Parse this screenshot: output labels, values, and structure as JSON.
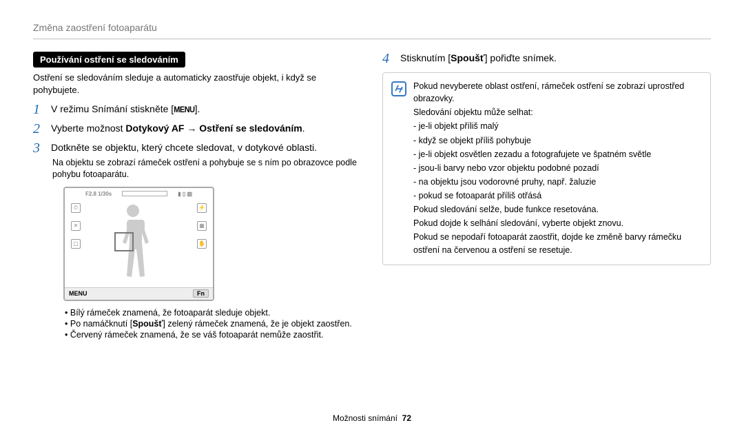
{
  "top_title": "Změna zaostření fotoaparátu",
  "left": {
    "heading": "Používání ostření se sledováním",
    "intro": "Ostření se sledováním sleduje a automaticky zaostřuje objekt, i když se pohybujete.",
    "step1": {
      "pre": "V režimu Snímání stiskněte [",
      "menu": "MENU",
      "post": "]."
    },
    "step2": {
      "pre": "Vyberte možnost ",
      "bold1": "Dotykový AF",
      "mid": " → ",
      "bold2": "Ostření se sledováním",
      "post": "."
    },
    "step3": {
      "main": "Dotkněte se objektu, který chcete sledovat, v dotykové oblasti.",
      "sub": "Na objektu se zobrazí rámeček ostření a pohybuje se s ním po obrazovce podle pohybu fotoaparátu."
    },
    "lcd": {
      "fval": "F2.8 1/30s",
      "menu_label": "MENU",
      "fn_label": "Fn"
    },
    "bullets": {
      "b1": "Bílý rámeček znamená, že fotoaparát sleduje objekt.",
      "b2a": "Po namáčknutí [",
      "b2b": "Spoušť",
      "b2c": "] zelený rámeček znamená, že je objekt zaostřen.",
      "b3": "Červený rámeček znamená, že se váš fotoaparát nemůže zaostřit."
    }
  },
  "right": {
    "step4": {
      "pre": "Stisknutím [",
      "bold": "Spoušť",
      "post": "] pořiďte snímek."
    },
    "note": {
      "l1": "Pokud nevyberete oblast ostření, rámeček ostření se zobrazí uprostřed obrazovky.",
      "l2": "Sledování objektu může selhat:",
      "d1": "je-li objekt příliš malý",
      "d2": "když se objekt příliš pohybuje",
      "d3": "je-li objekt osvětlen zezadu a fotografujete ve špatném světle",
      "d4": "jsou-li barvy nebo vzor objektu podobné pozadí",
      "d5": "na objektu jsou vodorovné pruhy, např. žaluzie",
      "d6": "pokud se fotoaparát příliš otřásá",
      "l3": "Pokud sledování selže, bude funkce resetována.",
      "l4": "Pokud dojde k selhání sledování, vyberte objekt znovu.",
      "l5": "Pokud se nepodaří fotoaparát zaostřit, dojde ke změně barvy rámečku ostření na červenou a ostření se resetuje."
    }
  },
  "footer": {
    "section": "Možnosti snímání",
    "page": "72"
  }
}
